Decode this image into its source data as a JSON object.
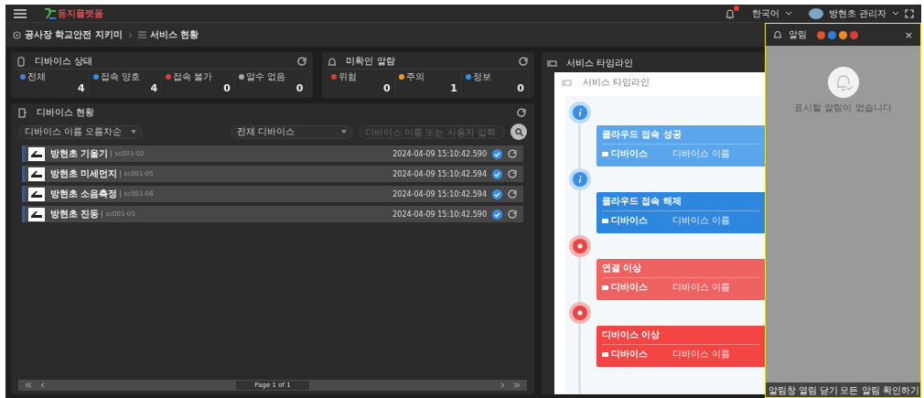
{
  "topbar": {
    "logo_text": "동지플랫폼",
    "language": "한국어",
    "user": "방현초 관리자"
  },
  "breadcrumb": [
    "공사장 학교안전 지키미",
    "서비스 현황"
  ],
  "device_status": {
    "title": "디바이스 상태",
    "stats": [
      {
        "label": "전체",
        "value": "4",
        "color": "#4a7fd6"
      },
      {
        "label": "접속 양호",
        "value": "4",
        "color": "#2f8fe0"
      },
      {
        "label": "접속 불가",
        "value": "0",
        "color": "#e03a3a"
      },
      {
        "label": "알수 없음",
        "value": "0",
        "color": "#aaaaaa"
      }
    ]
  },
  "alarms": {
    "title": "미확인 알람",
    "stats": [
      {
        "label": "위험",
        "value": "0",
        "color": "#e53935"
      },
      {
        "label": "주의",
        "value": "1",
        "color": "#f39c12"
      },
      {
        "label": "정보",
        "value": "0",
        "color": "#2196f3"
      }
    ]
  },
  "device_list": {
    "title": "디바이스 현황",
    "sort_select": "디바이스 이름 오름차순",
    "filter_select": "전체 디바이스",
    "search": {
      "placeholder": "디바이스 이름 또는 사용자 입력"
    },
    "devices": [
      {
        "name": "방현초 기울기",
        "id": "sc001-02",
        "time": "2024-04-09 15:10:42.590",
        "connected": true
      },
      {
        "name": "방현초 미세먼지",
        "id": "sc001-05",
        "time": "2024-04-09 15:10:42.594",
        "connected": true
      },
      {
        "name": "방현초 소음측정",
        "id": "sc001-06",
        "time": "2024-04-09 15:10:42.594",
        "connected": true
      },
      {
        "name": "방현초 진동",
        "id": "sc001-03",
        "time": "2024-04-09 15:10:42.590",
        "connected": true
      }
    ],
    "pagination": "Page 1 of 1"
  },
  "timeline": {
    "title": "서비스 타임라인",
    "inner_title": "서비스 타임라인",
    "events": [
      {
        "kind": "info",
        "title": "클라우드 접속 성공",
        "label": "디바이스",
        "value": "디바이스 이름",
        "color": "#5aa5ec"
      },
      {
        "kind": "info",
        "title": "클라우드 접속 해제",
        "label": "디바이스",
        "value": "디바이스 이름",
        "color": "#2e86de"
      },
      {
        "kind": "error",
        "title": "연결 이상",
        "label": "디바이스",
        "value": "디바이스 이름",
        "color": "#ef6262"
      },
      {
        "kind": "error",
        "title": "디바이스 이상",
        "label": "디바이스",
        "value": "디바이스 이름",
        "color": "#f44545"
      }
    ]
  },
  "alert_panel": {
    "title": "알림",
    "filters": [
      {
        "color": "#e0552b"
      },
      {
        "color": "#2f7fd6"
      },
      {
        "color": "#ef8a1f"
      },
      {
        "color": "#d93b3b"
      }
    ],
    "close": "×",
    "empty_message": "표시할 알림이 없습니다",
    "footer": [
      "알림창 열림 닫기",
      "모든 알림 확인하기"
    ]
  }
}
